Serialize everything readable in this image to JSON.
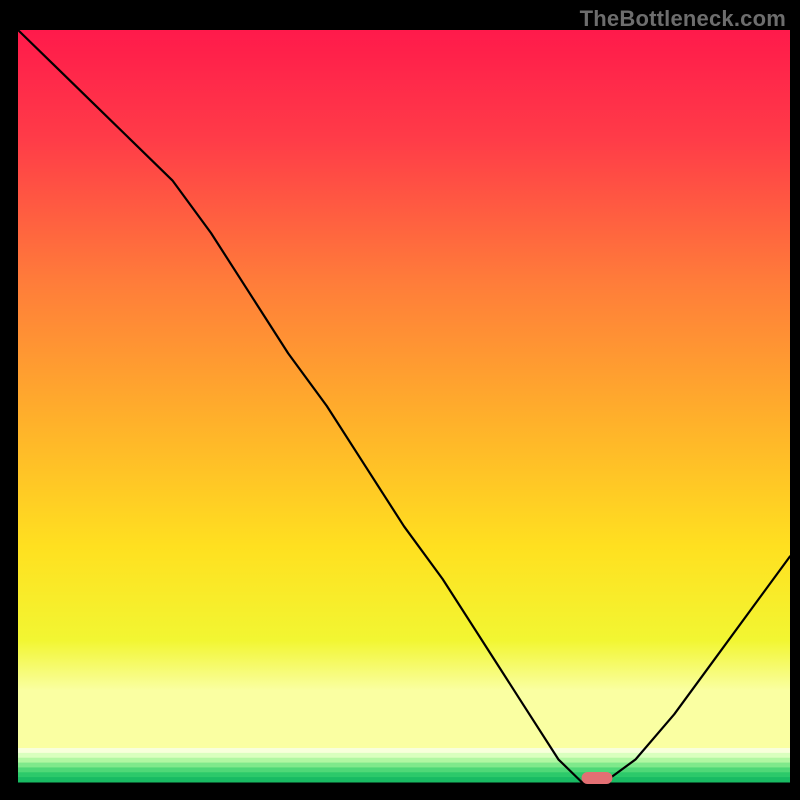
{
  "watermark": "TheBottleneck.com",
  "chart_data": {
    "type": "line",
    "title": "",
    "xlabel": "",
    "ylabel": "",
    "xlim": [
      0,
      100
    ],
    "ylim": [
      0,
      100
    ],
    "grid": false,
    "legend": false,
    "series": [
      {
        "name": "bottleneck-curve",
        "x": [
          0,
          5,
          10,
          15,
          20,
          25,
          30,
          35,
          40,
          45,
          50,
          55,
          60,
          65,
          70,
          73,
          76,
          80,
          85,
          90,
          95,
          100
        ],
        "y": [
          100,
          95,
          90,
          85,
          80,
          73,
          65,
          57,
          50,
          42,
          34,
          27,
          19,
          11,
          3,
          0,
          0,
          3,
          9,
          16,
          23,
          30
        ]
      }
    ],
    "marker": {
      "name": "optimal-range",
      "x_start": 73,
      "x_end": 77,
      "y": 0,
      "color": "#e36f73"
    },
    "background_gradient": {
      "main": [
        {
          "offset": 0.0,
          "color": "#ff1a4b"
        },
        {
          "offset": 0.15,
          "color": "#ff3b48"
        },
        {
          "offset": 0.35,
          "color": "#ff7c3a"
        },
        {
          "offset": 0.55,
          "color": "#ffb22a"
        },
        {
          "offset": 0.72,
          "color": "#ffe020"
        },
        {
          "offset": 0.85,
          "color": "#f2f632"
        },
        {
          "offset": 0.92,
          "color": "#faffa2"
        }
      ],
      "bottom_stripes": [
        "#f8ffdb",
        "#d9ffbe",
        "#b1f7a2",
        "#7fe98b",
        "#4fd877",
        "#2cc96a",
        "#19bb63"
      ]
    }
  }
}
